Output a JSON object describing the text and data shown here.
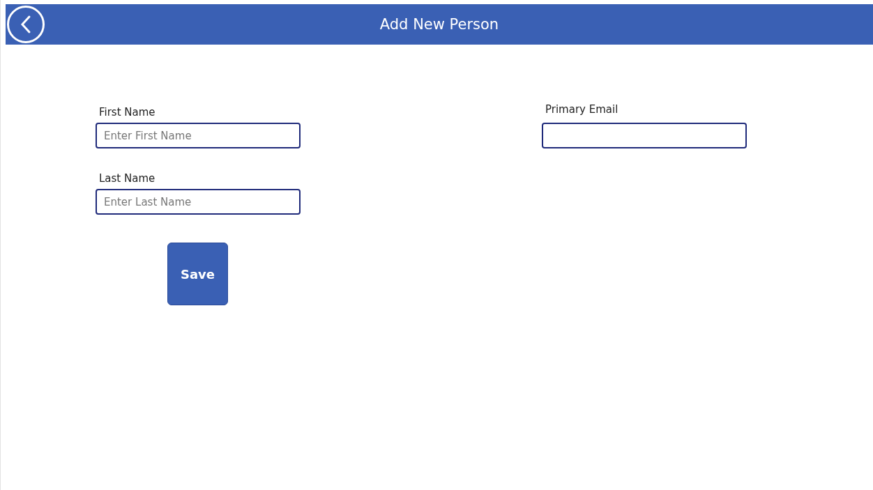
{
  "header": {
    "title": "Add New Person"
  },
  "left_fields": [
    {
      "label": "First Name",
      "placeholder": "Enter First Name"
    },
    {
      "label": "Last Name",
      "placeholder": "Enter Last Name"
    }
  ],
  "right_fields": [
    {
      "label": "Primary Email"
    }
  ],
  "save_button": {
    "label": "Save"
  }
}
